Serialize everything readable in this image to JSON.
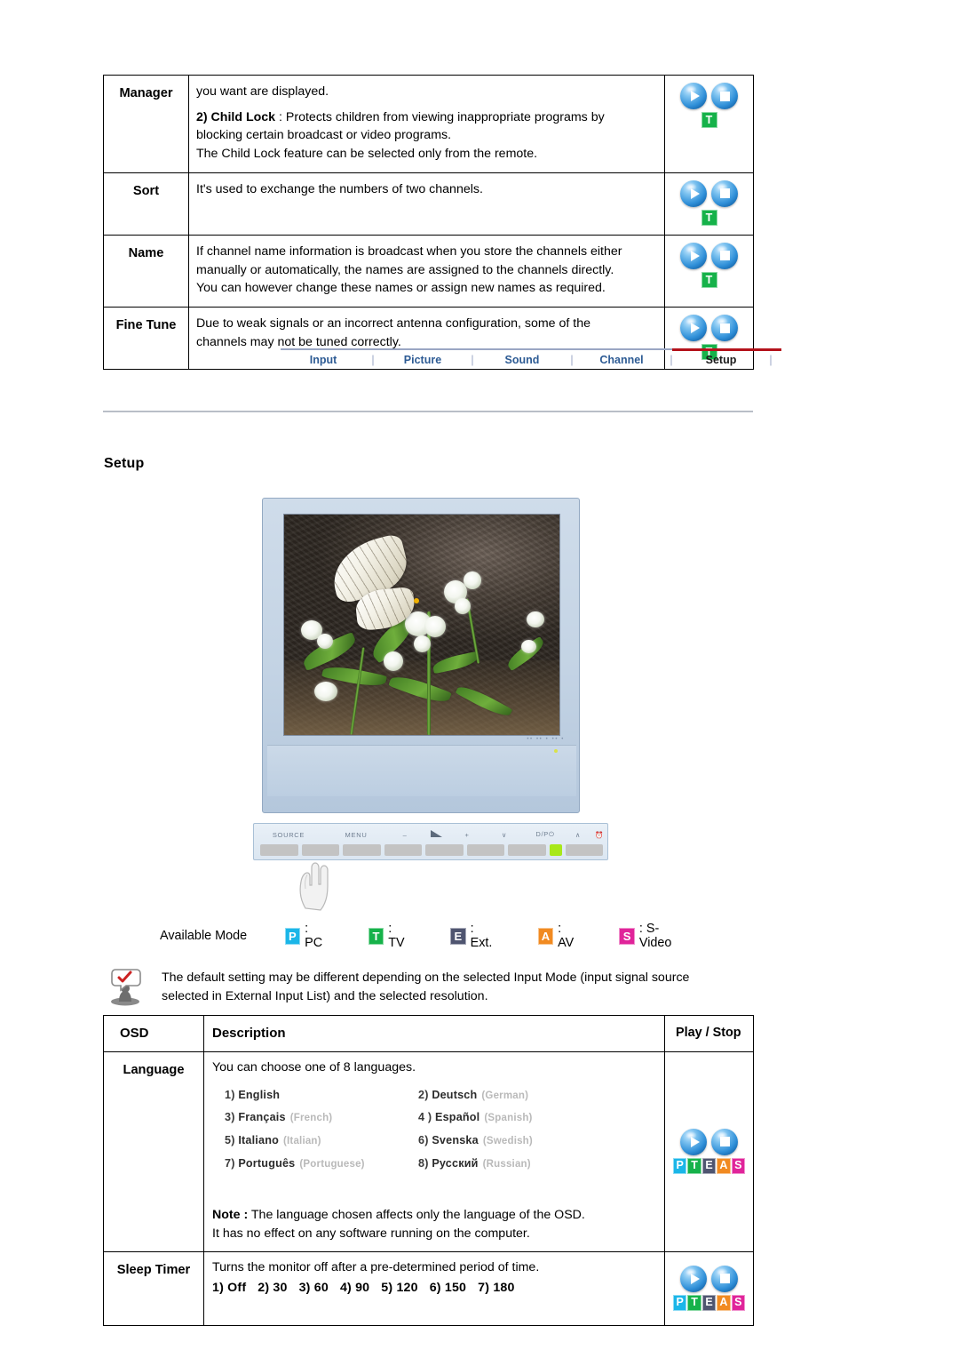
{
  "channel_table": {
    "rows": [
      {
        "label": "Manager",
        "lines": [
          {
            "text": "you want are displayed."
          },
          {
            "bold": "2) Child Lock",
            "text": " : Protects children from viewing inappropriate programs by"
          },
          {
            "text": "blocking certain broadcast or video programs."
          },
          {
            "text": "The Child Lock feature can be selected only from the remote."
          }
        ],
        "icons": {
          "play": "play-icon",
          "stop": "stop-icon",
          "modes": [
            "T"
          ]
        }
      },
      {
        "label": "Sort",
        "lines": [
          {
            "text": "It's used to exchange the numbers of two channels."
          }
        ],
        "icons": {
          "play": "play-icon",
          "stop": "stop-icon",
          "modes": [
            "T"
          ]
        }
      },
      {
        "label": "Name",
        "lines": [
          {
            "text": "If channel name information is broadcast when you store the channels either"
          },
          {
            "text": "manually or automatically, the names are assigned to the channels directly."
          },
          {
            "text": "You can however change these names or assign new names as required."
          }
        ],
        "icons": {
          "play": "play-icon",
          "stop": "stop-icon",
          "modes": [
            "T"
          ]
        }
      },
      {
        "label": "Fine Tune",
        "lines": [
          {
            "text": "Due to weak signals or an incorrect antenna configuration, some of the"
          },
          {
            "text": "channels may not be tuned correctly."
          }
        ],
        "icons": {
          "play": "play-icon",
          "stop": "stop-icon",
          "modes": [
            "T"
          ]
        }
      }
    ]
  },
  "nav": {
    "tabs": [
      {
        "label": "Input",
        "active": false
      },
      {
        "label": "Picture",
        "active": false
      },
      {
        "label": "Sound",
        "active": false
      },
      {
        "label": "Channel",
        "active": false
      },
      {
        "label": "Setup",
        "active": true
      }
    ],
    "separator": "|",
    "active_color": "#b4121b",
    "tab_color": "#2d5b94"
  },
  "section": {
    "heading": "Setup"
  },
  "monitor": {
    "controls": [
      "SOURCE",
      "MENU",
      "–",
      "volume-icon",
      "+",
      "∨",
      "D/P⏻",
      "∧",
      "power-icon"
    ],
    "logo_text": "•• ••  •  ••  •",
    "screen_alt": "butterfly-on-white-flowers"
  },
  "available_mode": {
    "title": "Available Mode",
    "items": [
      {
        "badge": "P",
        "label": ": PC",
        "color": "#1bb6e8"
      },
      {
        "badge": "T",
        "label": ": TV",
        "color": "#16b24a"
      },
      {
        "badge": "E",
        "label": ": Ext.",
        "color": "#4f5570"
      },
      {
        "badge": "A",
        "label": ": AV",
        "color": "#f18a21"
      },
      {
        "badge": "S",
        "label": ": S-Video",
        "color": "#e0249a"
      }
    ]
  },
  "note": {
    "line1": "The default setting may be different depending on the selected Input Mode (input signal source",
    "line2": "selected in External Input List) and the selected resolution."
  },
  "osd_table": {
    "headers": {
      "osd": "OSD",
      "description": "Description",
      "play_stop": "Play / Stop"
    },
    "rows": [
      {
        "label": "Language",
        "intro": "You can choose one of 8 languages.",
        "languages": [
          {
            "num": "1)",
            "native": "English",
            "en": ""
          },
          {
            "num": "2)",
            "native": "Deutsch",
            "en": "(German)"
          },
          {
            "num": "3)",
            "native": "Français",
            "en": "(French)"
          },
          {
            "num": "4 )",
            "native": "Español",
            "en": "(Spanish)"
          },
          {
            "num": "5)",
            "native": "Italiano",
            "en": "(Italian)"
          },
          {
            "num": "6)",
            "native": "Svenska",
            "en": "(Swedish)"
          },
          {
            "num": "7)",
            "native": "Português",
            "en": "(Portuguese)"
          },
          {
            "num": "8)",
            "native": "Русский",
            "en": "(Russian)"
          }
        ],
        "note_bold": "Note :",
        "note_rest": " The language chosen affects only the language of the OSD.",
        "note_line2": "It has no effect on any software running on the computer.",
        "icons": {
          "play": "play-icon",
          "stop": "stop-icon",
          "modes": [
            "P",
            "T",
            "E",
            "A",
            "S"
          ]
        }
      },
      {
        "label": "Sleep Timer",
        "intro": "Turns the monitor off after a pre-determined period of time.",
        "options": [
          "1) Off",
          "2) 30",
          "3) 60",
          "4) 90",
          "5) 120",
          "6) 150",
          "7) 180"
        ],
        "icons": {
          "play": "play-icon",
          "stop": "stop-icon",
          "modes": [
            "P",
            "T",
            "E",
            "A",
            "S"
          ]
        }
      }
    ]
  }
}
